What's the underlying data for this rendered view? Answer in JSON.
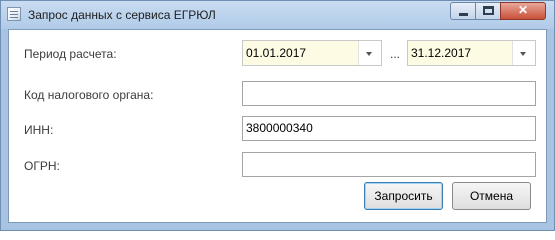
{
  "window": {
    "title": "Запрос данных с сервиса ЕГРЮЛ",
    "minimize_glyph": "",
    "maximize_glyph": "",
    "close_glyph": "✕"
  },
  "form": {
    "period_label": "Период расчета:",
    "period_from": "01.01.2017",
    "period_separator": "...",
    "period_to": "31.12.2017",
    "tax_code_label": "Код налогового органа:",
    "tax_code_value": "",
    "inn_label": "ИНН:",
    "inn_value": "3800000340",
    "ogrn_label": "ОГРН:",
    "ogrn_value": ""
  },
  "buttons": {
    "request": "Запросить",
    "cancel": "Отмена"
  },
  "icons": {
    "app": "window-app-icon",
    "minimize": "minimize-icon",
    "maximize": "maximize-icon",
    "close": "close-icon",
    "dropdown": "chevron-down-icon"
  },
  "colors": {
    "date_bg": "#fefbe4",
    "close_btn": "#c9503a",
    "titlebar": "#b0cbe8"
  }
}
